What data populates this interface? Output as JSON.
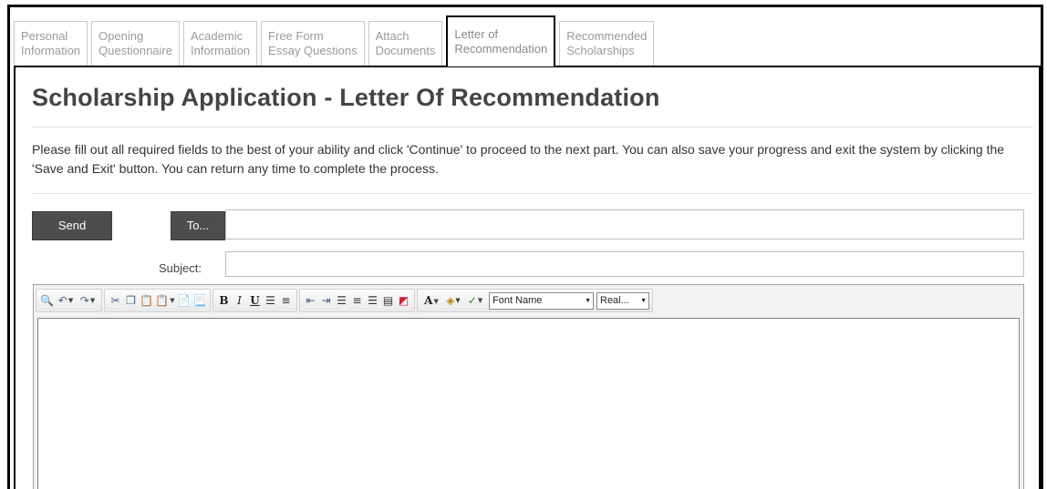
{
  "tabs": [
    {
      "line1": "Personal",
      "line2": "Information",
      "active": false
    },
    {
      "line1": "Opening",
      "line2": "Questionnaire",
      "active": false
    },
    {
      "line1": "Academic",
      "line2": "Information",
      "active": false
    },
    {
      "line1": "Free Form",
      "line2": "Essay Questions",
      "active": false
    },
    {
      "line1": "Attach",
      "line2": "Documents",
      "active": false
    },
    {
      "line1": "Letter of",
      "line2": "Recommendation",
      "active": true
    },
    {
      "line1": "Recommended",
      "line2": "Scholarships",
      "active": false
    }
  ],
  "page": {
    "title": "Scholarship Application - Letter Of Recommendation",
    "instructions": "Please fill out all required fields to the best of your ability and click 'Continue' to proceed to the next part. You can also save your progress and exit the system by clicking the 'Save and Exit' button. You can return any time to complete the process."
  },
  "compose": {
    "send_label": "Send",
    "to_label": "To...",
    "to_value": "",
    "subject_label": "Subject:",
    "subject_value": ""
  },
  "editor": {
    "font_name": "Font Name",
    "font_size": "Real...",
    "body": ""
  },
  "icons": {
    "find": "binoculars-icon",
    "undo": "undo-icon",
    "redo": "redo-icon",
    "cut": "cut-icon",
    "copy": "copy-icon",
    "paste": "paste-icon"
  },
  "colors": {
    "button_bg": "#4d4d4d",
    "tab_text": "#9a9a9a",
    "title_text": "#444444"
  }
}
